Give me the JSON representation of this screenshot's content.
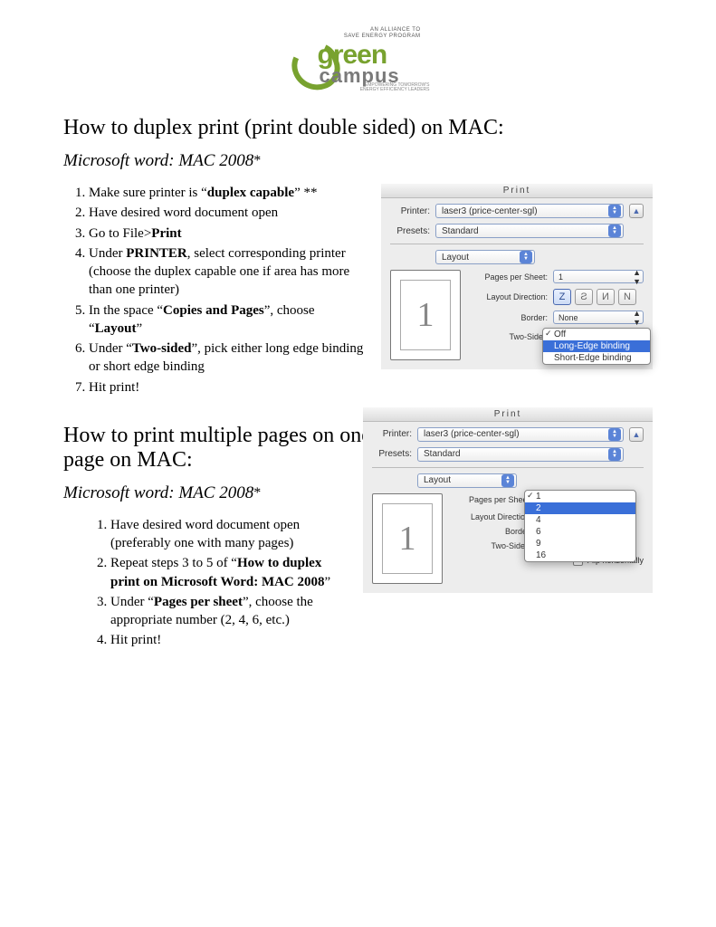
{
  "logo": {
    "tag_top1": "AN ALLIANCE TO",
    "tag_top2": "SAVE ENERGY PROGRAM",
    "word_green": "green",
    "word_campus": "campus",
    "tag_bot1": "EMPOWERING TOMORROW'S",
    "tag_bot2": "ENERGY EFFICIENCY LEADERS"
  },
  "section1": {
    "title": "How to duplex print (print double sided) on MAC:",
    "subtitle_italic": "Microsoft word: MAC 2008",
    "subtitle_ast": "*",
    "steps": [
      {
        "pre": "Make sure printer is “",
        "b": "duplex capable",
        "post": "” **"
      },
      {
        "pre": "Have desired word document open",
        "b": "",
        "post": ""
      },
      {
        "pre": "Go to File>",
        "b": "Print",
        "post": ""
      },
      {
        "pre": "Under ",
        "b": "PRINTER",
        "post": ", select corresponding printer (choose the duplex capable one if area has more than one printer)"
      },
      {
        "pre": "In the space “",
        "b": "Copies and Pages",
        "post": "”, choose “",
        "b2": "Layout",
        "post2": "”"
      },
      {
        "pre": "Under “",
        "b": "Two-sided",
        "post": "”, pick either long edge binding or short edge binding"
      },
      {
        "pre": "Hit print!",
        "b": "",
        "post": ""
      }
    ]
  },
  "dlg1": {
    "title": "Print",
    "printer_label": "Printer:",
    "printer_value": "laser3 (price-center-sgl)",
    "presets_label": "Presets:",
    "presets_value": "Standard",
    "layout_value": "Layout",
    "pps_label": "Pages per Sheet:",
    "pps_value": "1",
    "dir_label": "Layout Direction:",
    "border_label": "Border:",
    "border_value": "None",
    "twosided_label": "Two-Sided",
    "popup": {
      "off": "Off",
      "long": "Long-Edge binding",
      "short": "Short-Edge binding"
    },
    "preview_num": "1"
  },
  "section2": {
    "title": "How to print multiple pages on one page on MAC:",
    "subtitle_italic": "Microsoft word: MAC 2008",
    "subtitle_ast": "*",
    "steps": [
      {
        "pre": "Have desired word document open (preferably one with many pages)",
        "b": "",
        "post": ""
      },
      {
        "pre": "Repeat steps 3 to 5 of “",
        "b": "How to duplex print on Microsoft Word: MAC 2008",
        "post": "”"
      },
      {
        "pre": "Under “",
        "b": "Pages per sheet",
        "post": "”, choose the appropriate number (2, 4, 6, etc.)"
      },
      {
        "pre": "Hit print!",
        "b": "",
        "post": ""
      }
    ]
  },
  "dlg2": {
    "title": "Print",
    "printer_label": "Printer:",
    "printer_value": "laser3 (price-center-sgl)",
    "presets_label": "Presets:",
    "presets_value": "Standard",
    "layout_value": "Layout",
    "pps_label": "Pages per Sheet",
    "dir_label": "Layout Direction",
    "border_label": "Border",
    "twosided_label": "Two-Sided",
    "flip_label": "Flip horizontally",
    "preview_num": "1",
    "pps_options": [
      "1",
      "2",
      "4",
      "6",
      "9",
      "16"
    ]
  }
}
